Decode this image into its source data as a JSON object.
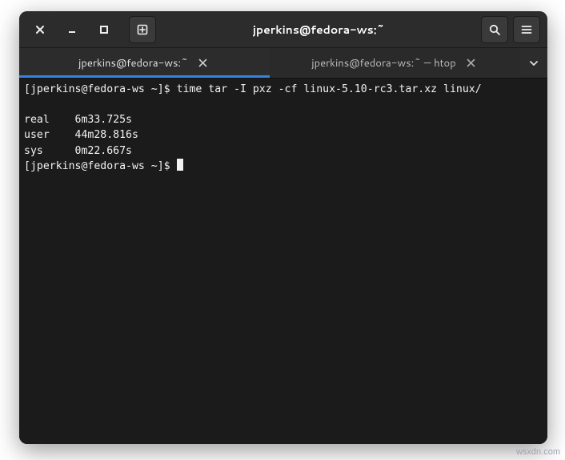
{
  "titlebar": {
    "title": "jperkins@fedora-ws:~"
  },
  "tabs": [
    {
      "label": "jperkins@fedora-ws:~",
      "active": true
    },
    {
      "label": "jperkins@fedora-ws:~ — htop",
      "active": false
    }
  ],
  "terminal": {
    "prompt1": "[jperkins@fedora-ws ~]$ ",
    "command1": "time tar -I pxz -cf linux-5.10-rc3.tar.xz linux/",
    "results": [
      "real    6m33.725s",
      "user    44m28.816s",
      "sys     0m22.667s"
    ],
    "prompt2": "[jperkins@fedora-ws ~]$ "
  },
  "watermark": "wsxdn.com"
}
